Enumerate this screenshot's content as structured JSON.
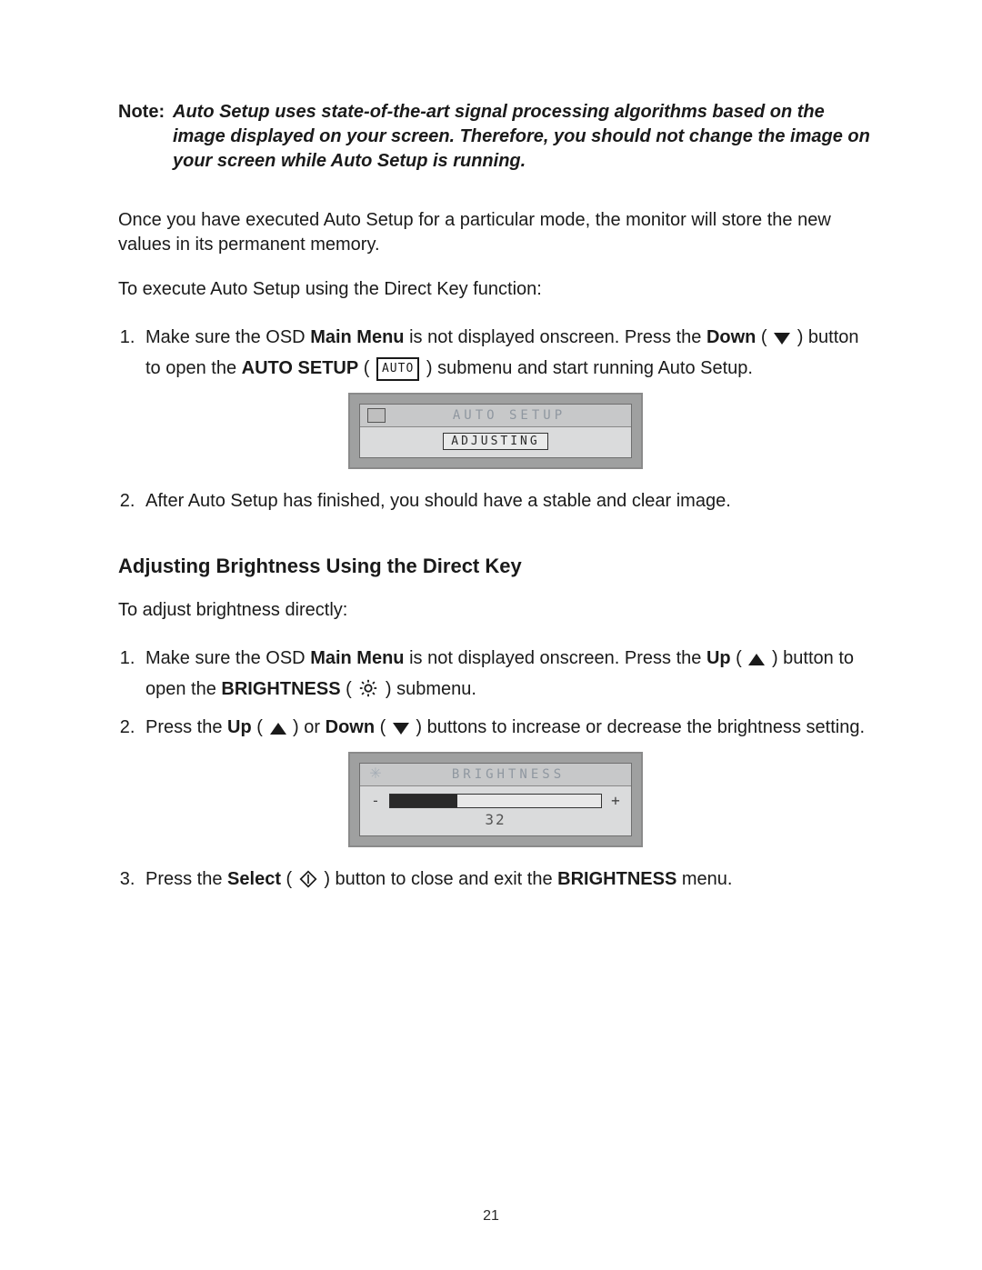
{
  "note": {
    "label": "Note:",
    "text": "Auto Setup uses state-of-the-art signal processing algorithms based on the image displayed on your screen. Therefore, you should not change the image on your screen while Auto Setup is running."
  },
  "intro_para": "Once you have executed Auto Setup for a particular mode, the monitor will store the new values in its permanent memory.",
  "exec_line": "To execute Auto Setup using the Direct Key function:",
  "step1": {
    "a": "Make sure the OSD ",
    "main_menu": "Main Menu",
    "b": " is not displayed onscreen. Press the ",
    "down": "Down",
    "c": " ( ",
    "d": " ) button to open the ",
    "auto_setup": "AUTO SETUP",
    "e": " ( ",
    "auto_chip": "AUTO",
    "f": " ) submenu and start running Auto Setup."
  },
  "osd1": {
    "title": "AUTO SETUP",
    "status": "ADJUSTING"
  },
  "step2": "After Auto Setup has finished, you should have a stable and clear image.",
  "section_heading": "Adjusting Brightness Using the Direct Key",
  "adjust_line": "To adjust brightness directly:",
  "bstep1": {
    "a": "Make sure the OSD ",
    "main_menu": "Main Menu",
    "b": " is not displayed onscreen. Press the ",
    "up": "Up",
    "c": " ( ",
    "d": " ) button to open the ",
    "brightness": "BRIGHTNESS",
    "e": " ( ",
    "f": " ) submenu."
  },
  "bstep2": {
    "a": "Press the ",
    "up": "Up",
    "b": " ( ",
    "c": " ) or ",
    "down": "Down",
    "d": " ( ",
    "e": " ) buttons to increase or decrease the brightness setting."
  },
  "osd2": {
    "title": "BRIGHTNESS",
    "minus": "-",
    "plus": "+",
    "value": "32",
    "fill_percent": 32
  },
  "bstep3": {
    "a": "Press the ",
    "select": "Select",
    "b": " ( ",
    "c": " ) button to close and exit the ",
    "brightness": "BRIGHTNESS",
    "d": " menu."
  },
  "page_number": "21"
}
